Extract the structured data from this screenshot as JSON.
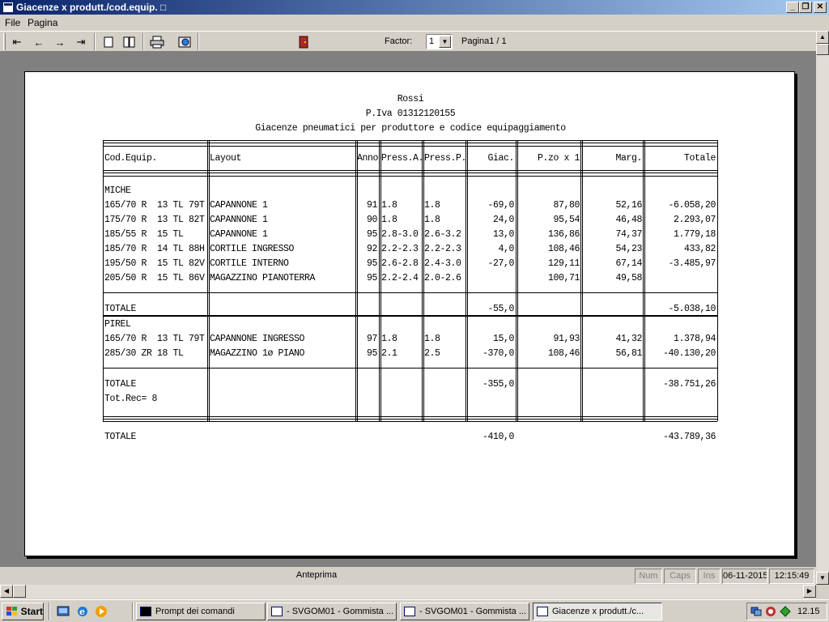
{
  "window": {
    "title": "Giacenze x produtt./cod.equip. □",
    "icon": "app-window-icon",
    "buttons": [
      "minimize",
      "restore",
      "close"
    ]
  },
  "menu": {
    "file": "File",
    "pagina": "Pagina"
  },
  "toolbar": {
    "factor_label": "Factor:",
    "factor_value": "1",
    "page_label": "Pagina1 / 1",
    "icons": [
      "first-page-icon",
      "prev-page-icon",
      "next-page-icon",
      "last-page-icon",
      "single-page-icon",
      "two-pages-icon",
      "print-icon",
      "export-icon",
      "exit-door-icon"
    ]
  },
  "report": {
    "company": "Rossi",
    "piva": "P.Iva 01312120155",
    "subtitle": "Giacenze pneumatici per produttore e codice equipaggiamento",
    "columns": [
      "Cod.Equip.",
      "Layout",
      "Anno",
      "Press.A.",
      "Press.P.",
      "Giac.",
      "P.zo x 1",
      "Marg.",
      "Totale"
    ],
    "groups": [
      {
        "name": "MICHE",
        "rows": [
          [
            "165/70 R  13 TL 79T",
            "CAPANNONE 1",
            "91",
            "1.8",
            "1.8",
            "-69,0",
            "87,80",
            "52,16",
            "-6.058,20"
          ],
          [
            "175/70 R  13 TL 82T",
            "CAPANNONE 1",
            "90",
            "1.8",
            "1.8",
            "24,0",
            "95,54",
            "46,48",
            "2.293,07"
          ],
          [
            "185/55 R  15 TL",
            "CAPANNONE 1",
            "95",
            "2.8-3.0",
            "2.6-3.2",
            "13,0",
            "136,86",
            "74,37",
            "1.779,18"
          ],
          [
            "185/70 R  14 TL 88H",
            "CORTILE INGRESSO",
            "92",
            "2.2-2.3",
            "2.2-2.3",
            "4,0",
            "108,46",
            "54,23",
            "433,82"
          ],
          [
            "195/50 R  15 TL 82V",
            "CORTILE INTERNO",
            "95",
            "2.6-2.8",
            "2.4-3.0",
            "-27,0",
            "129,11",
            "67,14",
            "-3.485,97"
          ],
          [
            "205/50 R  15 TL 86V",
            "MAGAZZINO PIANOTERRA",
            "95",
            "2.2-2.4",
            "2.0-2.6",
            "",
            "100,71",
            "49,58",
            ""
          ]
        ],
        "total_label": "TOTALE",
        "total_giac": "-55,0",
        "total_totale": "-5.038,10"
      },
      {
        "name": "PIREL",
        "rows": [
          [
            "165/70 R  13 TL 79T",
            "CAPANNONE INGRESSO",
            "97",
            "1.8",
            "1.8",
            "15,0",
            "91,93",
            "41,32",
            "1.378,94"
          ],
          [
            "285/30 ZR 18 TL",
            "MAGAZZINO 1ø PIANO",
            "95",
            "2.1",
            "2.5",
            "-370,0",
            "108,46",
            "56,81",
            "-40.130,20"
          ]
        ],
        "total_label": "TOTALE",
        "total_giac": "-355,0",
        "total_totale": "-38.751,26"
      }
    ],
    "tot_rec": "Tot.Rec= 8",
    "grand_total_label": "TOTALE",
    "grand_total_giac": "-410,0",
    "grand_total_totale": "-43.789,36"
  },
  "statusbar": {
    "mode": "Anteprima",
    "num": "Num",
    "caps": "Caps",
    "ins": "Ins",
    "date": "06-11-2015",
    "time": "12:15:49"
  },
  "taskbar": {
    "start": "Start",
    "quicklaunch": [
      "show-desktop-icon",
      "internet-explorer-icon",
      "media-player-icon"
    ],
    "tasks": [
      {
        "label": "Prompt dei comandi",
        "icon": "cmd-icon",
        "active": false
      },
      {
        "label": "- SVGOM01 - Gommista  ...",
        "icon": "window-icon",
        "active": false
      },
      {
        "label": "- SVGOM01 - Gommista  ...",
        "icon": "window-icon",
        "active": false
      },
      {
        "label": "Giacenze x produtt./c...",
        "icon": "window-icon",
        "active": true
      }
    ],
    "clock": "12.15",
    "tray_icons": [
      "network-icon",
      "security-icon",
      "safely-remove-icon"
    ]
  }
}
